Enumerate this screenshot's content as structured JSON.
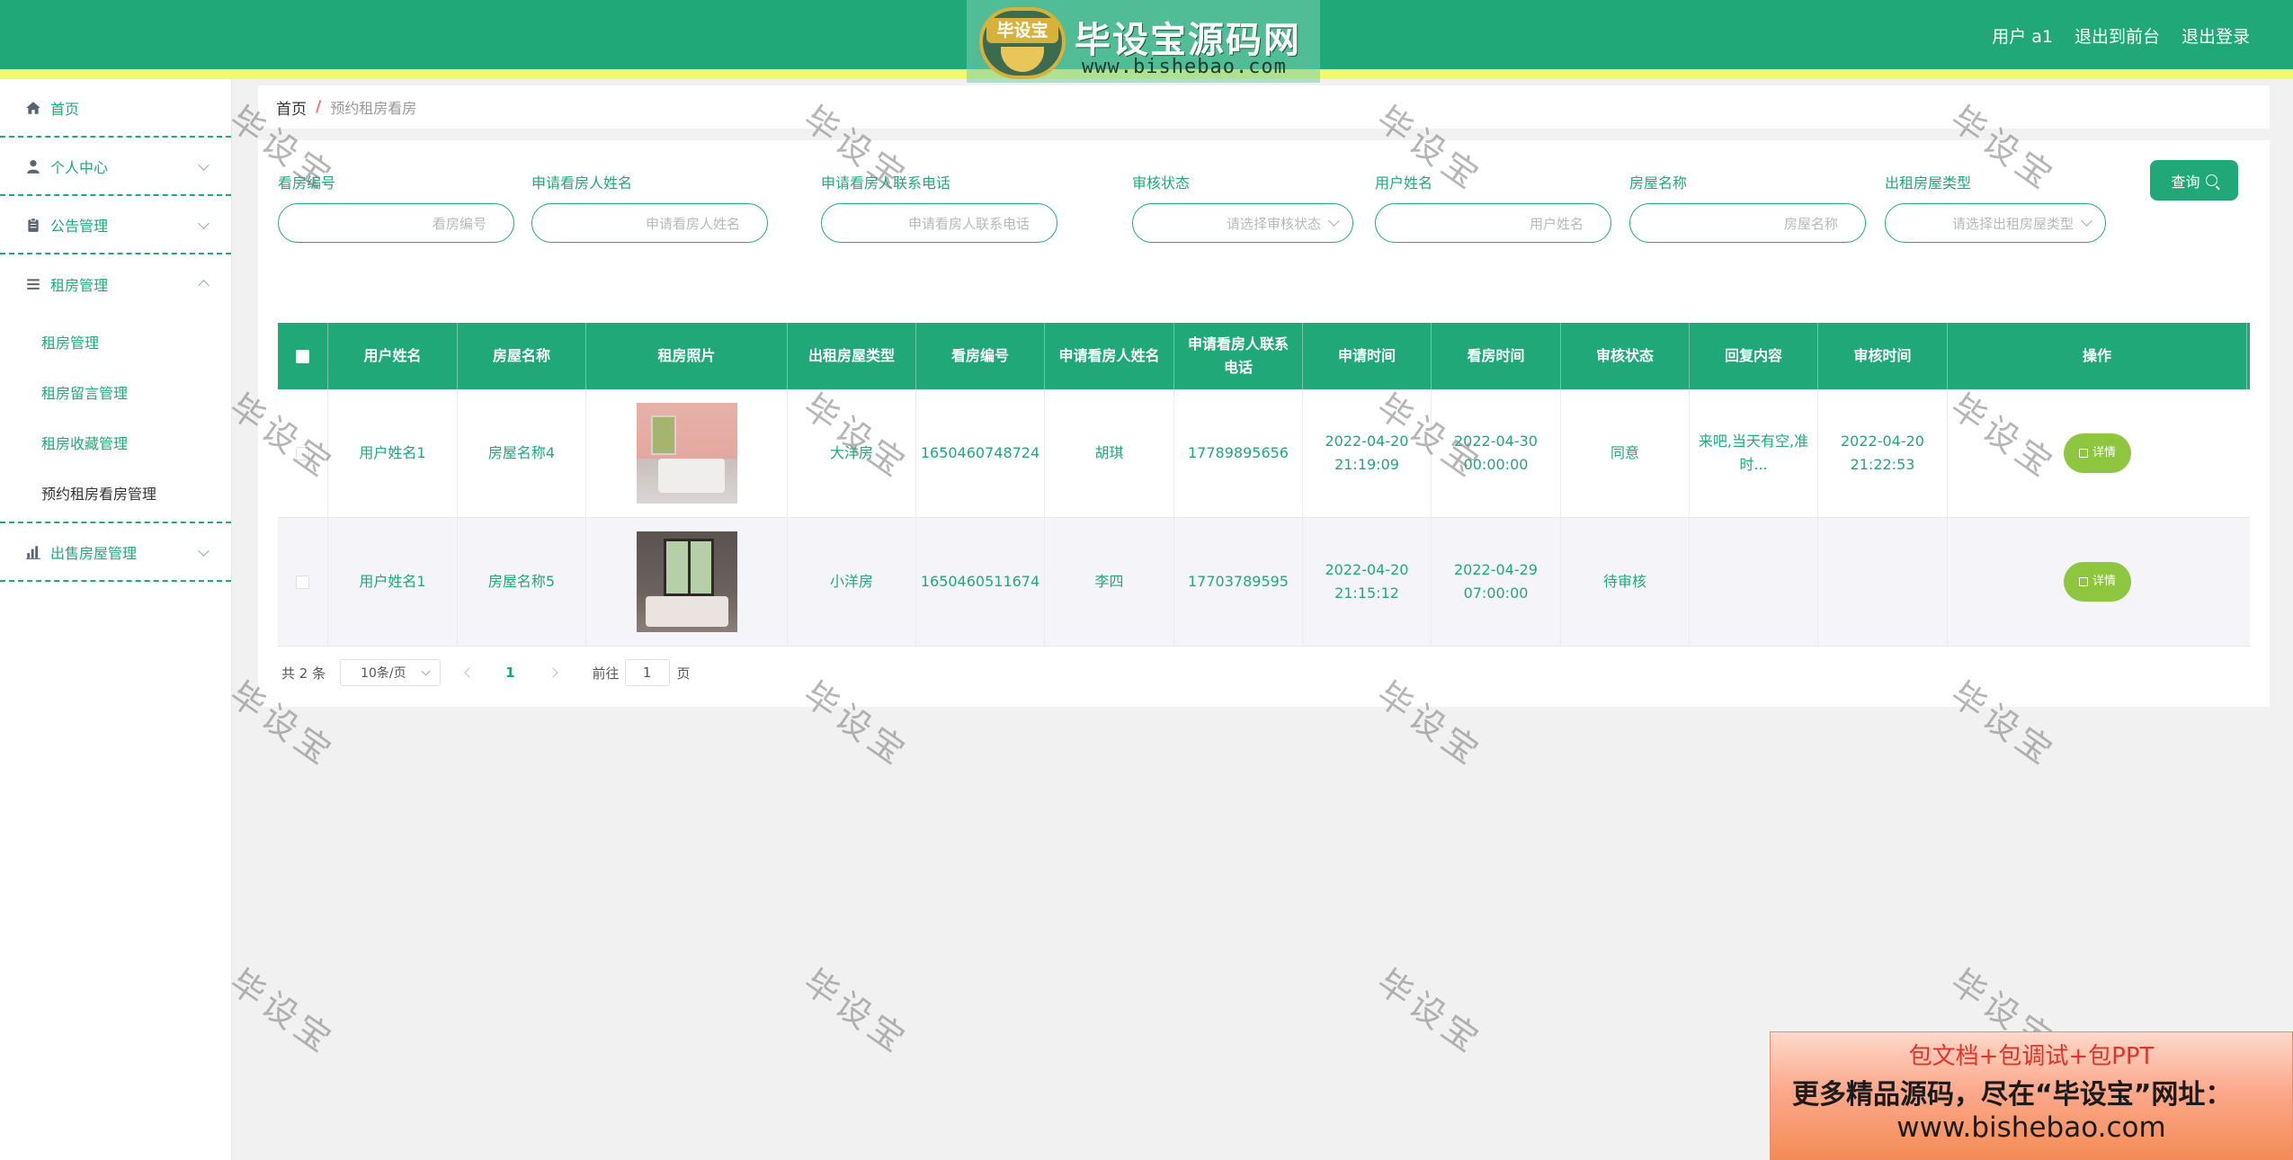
{
  "header": {
    "logo_badge": "毕设宝",
    "logo_title": "毕设宝源码网",
    "logo_url": "www.bishebao.com",
    "user": "用户 a1",
    "back_to_front": "退出到前台",
    "logout": "退出登录",
    "accent_color": "#21a879",
    "stripe_color": "#f2f96a"
  },
  "sidebar": {
    "home": "首页",
    "personal": "个人中心",
    "notice": "公告管理",
    "rent_mgmt": "租房管理",
    "sub_items": [
      "租房管理",
      "租房留言管理",
      "租房收藏管理",
      "预约租房看房管理"
    ],
    "sale_mgmt": "出售房屋管理"
  },
  "breadcrumb": {
    "home": "首页",
    "separator": "/",
    "current": "预约租房看房"
  },
  "search": {
    "fields": [
      {
        "label": "看房编号",
        "placeholder": "看房编号"
      },
      {
        "label": "申请看房人姓名",
        "placeholder": "申请看房人姓名"
      },
      {
        "label": "申请看房人联系电话",
        "placeholder": "申请看房人联系电话"
      },
      {
        "label": "审核状态",
        "placeholder": "请选择审核状态"
      },
      {
        "label": "用户姓名",
        "placeholder": "用户姓名"
      },
      {
        "label": "房屋名称",
        "placeholder": "房屋名称"
      },
      {
        "label": "出租房屋类型",
        "placeholder": "请选择出租房屋类型"
      }
    ],
    "query_label": "查询"
  },
  "table": {
    "columns": [
      "用户姓名",
      "房屋名称",
      "租房照片",
      "出租房屋类型",
      "看房编号",
      "申请看房人姓名",
      "申请看房人联系电话",
      "申请时间",
      "看房时间",
      "审核状态",
      "回复内容",
      "审核时间",
      "操作"
    ],
    "rows": [
      {
        "user_name": "用户姓名1",
        "house_name": "房屋名称4",
        "house_type": "大洋房",
        "view_no": "1650460748724",
        "applicant": "胡琪",
        "phone": "17789895656",
        "apply_time": "2022-04-20 21:19:09",
        "view_time": "2022-04-30 00:00:00",
        "status": "同意",
        "reply": "来吧,当天有空,准时...",
        "review_time": "2022-04-20 21:22:53",
        "action": "详情"
      },
      {
        "user_name": "用户姓名1",
        "house_name": "房屋名称5",
        "house_type": "小洋房",
        "view_no": "1650460511674",
        "applicant": "李四",
        "phone": "17703789595",
        "apply_time": "2022-04-20 21:15:12",
        "view_time": "2022-04-29 07:00:00",
        "status": "待审核",
        "reply": "",
        "review_time": "",
        "action": "详情"
      }
    ]
  },
  "pagination": {
    "total": "共 2 条",
    "page_size": "10条/页",
    "current_page": "1",
    "goto_prefix": "前往",
    "goto_value": "1",
    "goto_suffix": "页"
  },
  "watermark": "毕设宝",
  "promo": {
    "line1": "包文档+包调试+包PPT",
    "line2": "更多精品源码，尽在“毕设宝”网址：",
    "line3": "www.bishebao.com"
  }
}
